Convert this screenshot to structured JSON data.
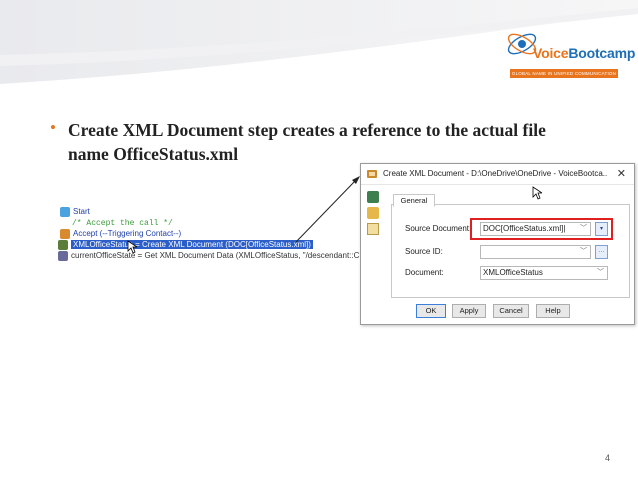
{
  "logo": {
    "brand_left": "Voice",
    "brand_right": "Bootcamp",
    "tagline": "GLOBAL NAME IN UNIFIED COMMUNICATION"
  },
  "bullet": {
    "text": "Create XML Document step creates a reference to the actual file name OfficeStatus.xml"
  },
  "script": {
    "rows": [
      {
        "text": "Start"
      },
      {
        "text": "/* Accept the call */"
      },
      {
        "text": "Accept (--Triggering Contact--)"
      },
      {
        "text": "XMLOfficeStatus = Create XML Document (DOC[OfficeStatus.xml])"
      },
      {
        "text": "currentOfficeState = Get XML Document Data (XMLOfficeStatus, \"/descendant::CURRENTS"
      }
    ]
  },
  "dialog": {
    "title": "Create XML Document - D:\\OneDrive\\OneDrive - VoiceBootca...",
    "close": "✕",
    "tab": "General",
    "fields": [
      {
        "label": "Source Document:",
        "value": "DOC[OfficeStatus.xml]|"
      },
      {
        "label": "Source ID:",
        "value": ""
      },
      {
        "label": "Document:",
        "value": "XMLOfficeStatus"
      }
    ],
    "buttons": {
      "ok": "OK",
      "apply": "Apply",
      "cancel": "Cancel",
      "help": "Help"
    }
  },
  "page_number": "4",
  "colors": {
    "accent": "#e8741e",
    "brand": "#1d6fb8",
    "highlight": "#2b5ec9",
    "red_box": "#e02020"
  }
}
